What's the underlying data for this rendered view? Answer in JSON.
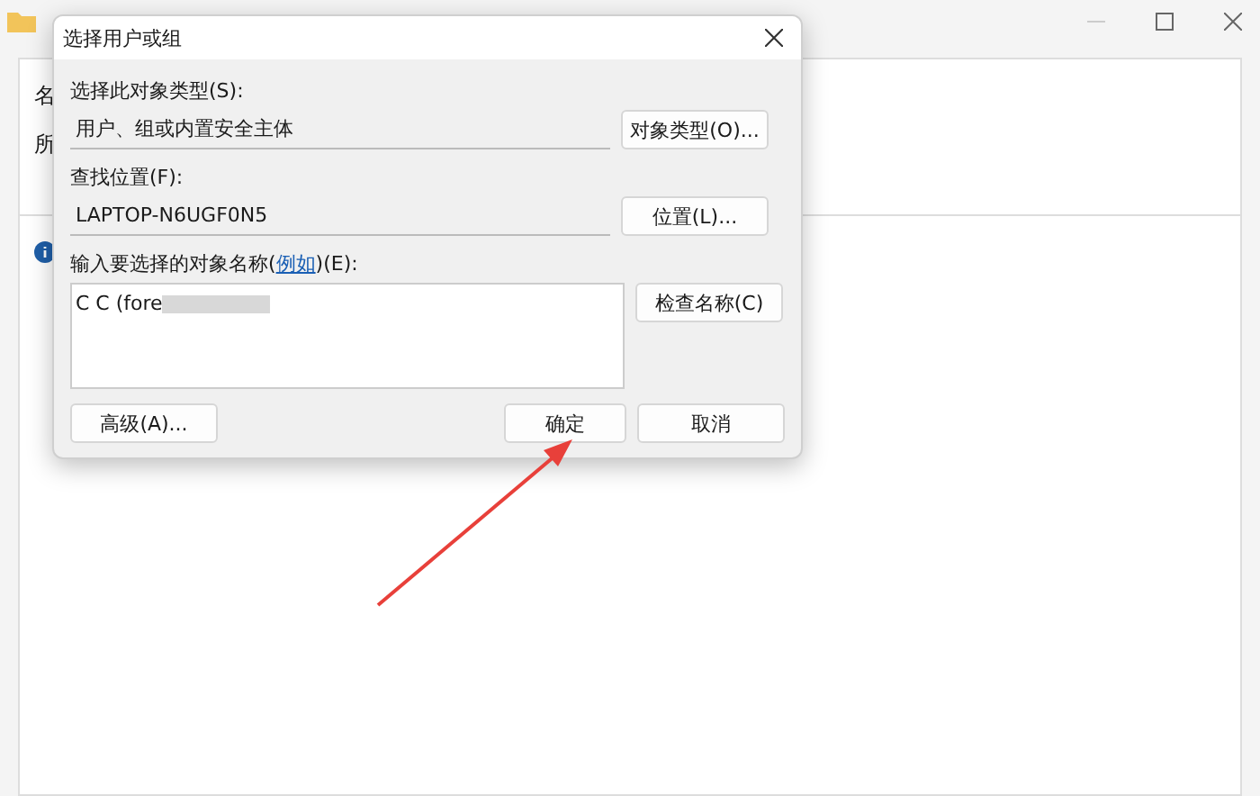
{
  "background_window": {
    "partial_labels": [
      "名",
      "所"
    ]
  },
  "dialog": {
    "title": "选择用户或组",
    "sections": [
      {
        "label": "选择此对象类型(S):",
        "value": "用户、组或内置安全主体",
        "button": "对象类型(O)..."
      },
      {
        "label": "查找位置(F):",
        "value": "LAPTOP-N6UGF0N5",
        "button": "位置(L)..."
      }
    ],
    "names_label": {
      "before": "输入要选择的对象名称(",
      "link": "例如",
      "after": ")(E):"
    },
    "names_value": "C C (fore",
    "check_button": "检查名称(C)",
    "advanced_button": "高级(A)...",
    "ok_button": "确定",
    "cancel_button": "取消"
  }
}
